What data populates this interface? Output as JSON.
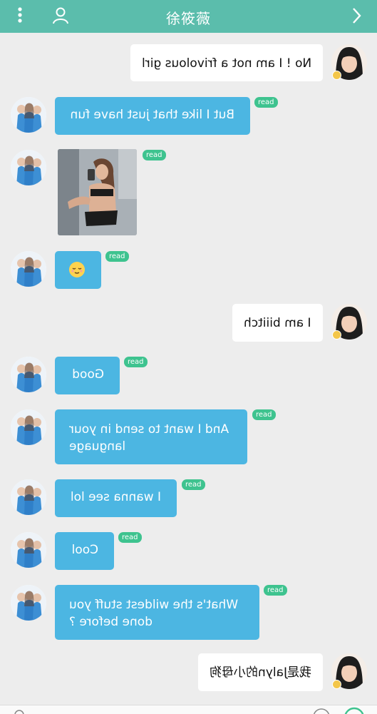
{
  "header": {
    "title": "徐筱薇",
    "menu_icon": "more-vertical-icon",
    "profile_icon": "person-icon",
    "back_icon": "chevron-icon"
  },
  "colors": {
    "header": "#5bbdac",
    "incoming_bubble": "#4cb6e2",
    "outgoing_bubble": "#ffffff",
    "read_badge": "#3ec38f",
    "background": "#ededed"
  },
  "messages": [
    {
      "dir": "out",
      "text": "No ! I am not a frivolous girl"
    },
    {
      "dir": "in",
      "text": "But I like that just have fun",
      "status": "read"
    },
    {
      "dir": "in",
      "type": "image",
      "status": "read"
    },
    {
      "dir": "in",
      "type": "emoji",
      "emoji": "relieved-face-emoji",
      "status": "read"
    },
    {
      "dir": "out",
      "text": "I am biiitch"
    },
    {
      "dir": "in",
      "text": "Good",
      "status": "read"
    },
    {
      "dir": "in",
      "text": "And I want to send in your language",
      "status": "read"
    },
    {
      "dir": "in",
      "text": "I wanna see lol",
      "status": "read"
    },
    {
      "dir": "in",
      "text": "Cool",
      "status": "read"
    },
    {
      "dir": "in",
      "text": "What's the wildest stuff you done before ?",
      "status": "read"
    },
    {
      "dir": "out",
      "text": "我是Jalyn的小母狗"
    }
  ]
}
